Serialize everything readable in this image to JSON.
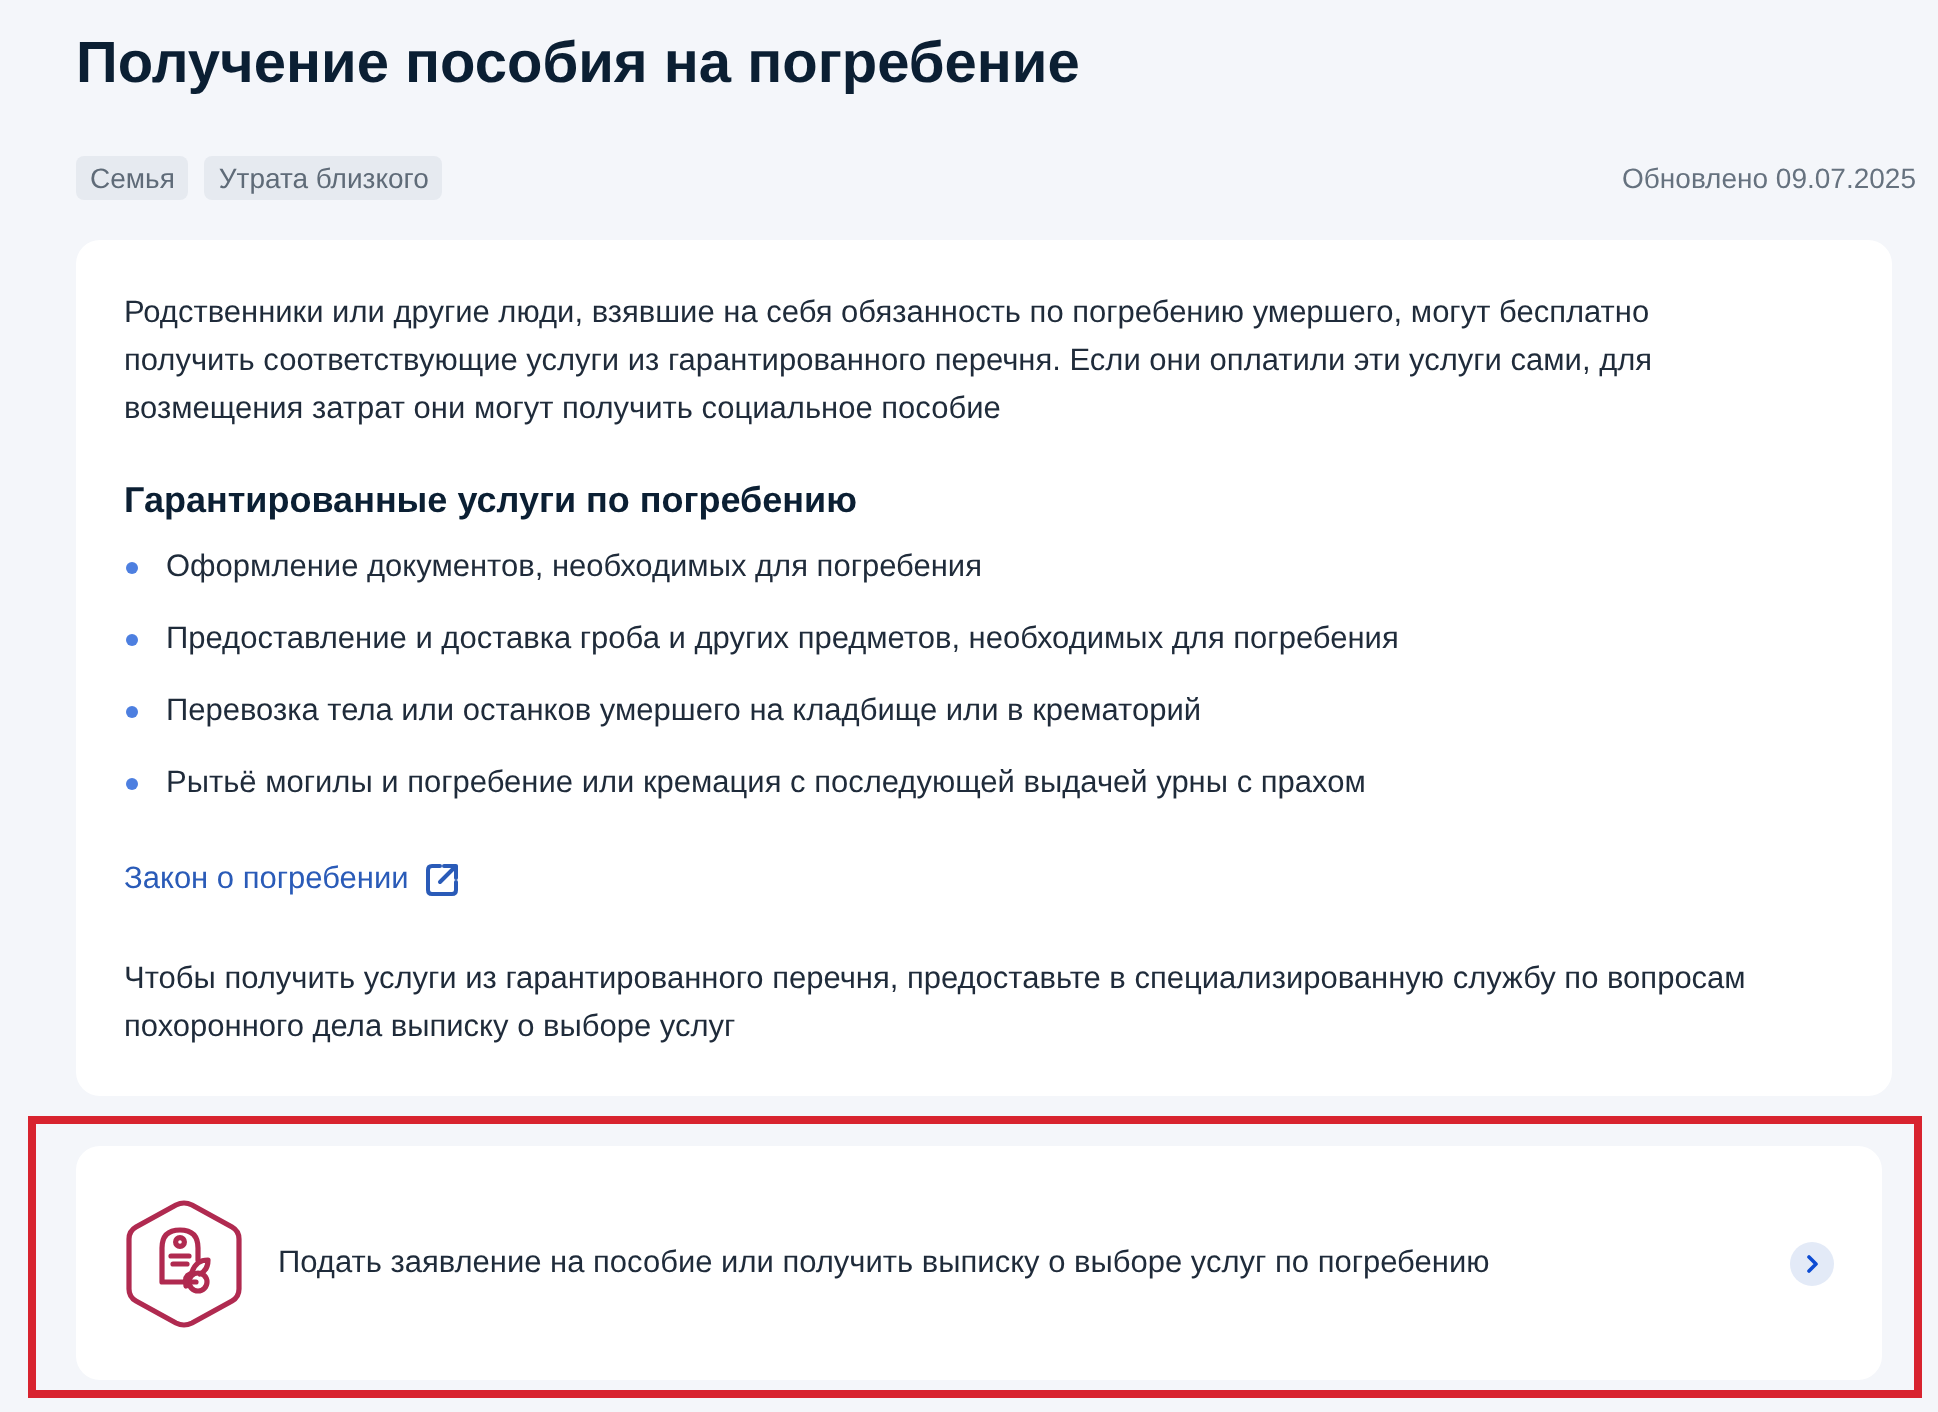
{
  "page": {
    "title": "Получение пособия на погребение",
    "tags": [
      "Семья",
      "Утрата близкого"
    ],
    "updated": "Обновлено 09.07.2025"
  },
  "info_card": {
    "intro": "Родственники или другие люди, взявшие на себя обязанность по погребению умершего, могут бесплатно получить соответствующие услуги из гарантированного перечня. Если они оплатили эти услуги сами, для возмещения затрат они могут получить социальное пособие",
    "services_heading": "Гарантированные услуги по погребению",
    "services": [
      "Оформление документов, необходимых для погребения",
      "Предоставление и доставка гроба и других предметов, необходимых для погребения",
      "Перевозка тела или останков умершего на кладбище или в крематорий",
      "Рытьё могилы и погребение или кремация с последующей выдачей урны с прахом"
    ],
    "law_link": "Закон о погребении",
    "note": "Чтобы получить услуги из гарантированного перечня, предоставьте в специализированную службу по вопросам похоронного дела выписку о выборе услуг"
  },
  "action_card": {
    "label": "Подать заявление на пособие или получить выписку о выборе услуг по погребению",
    "highlighted": true
  }
}
